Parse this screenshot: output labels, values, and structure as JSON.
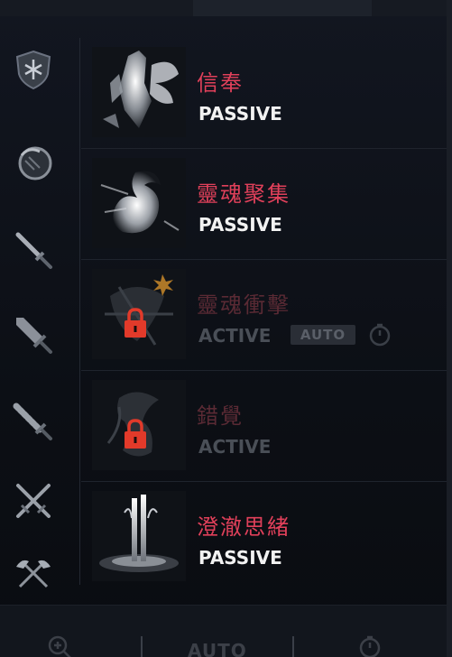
{
  "skills": [
    {
      "name": "信奉",
      "type": "PASSIVE",
      "locked": false
    },
    {
      "name": "靈魂聚集",
      "type": "PASSIVE",
      "locked": false
    },
    {
      "name": "靈魂衝擊",
      "type": "ACTIVE",
      "locked": true,
      "badge": "AUTO"
    },
    {
      "name": "錯覺",
      "type": "ACTIVE",
      "locked": true
    },
    {
      "name": "澄澈思緒",
      "type": "PASSIVE",
      "locked": false
    }
  ],
  "rail": {
    "icons": [
      "shield-emblem-icon",
      "ring-icon",
      "sword-icon",
      "broadsword-icon",
      "serrated-sword-icon",
      "crossed-swords-icon",
      "crossed-axes-icon"
    ]
  },
  "bottom_bar": {
    "auto_label": "AUTO",
    "icons": [
      "zoom-icon",
      "timer-icon"
    ]
  },
  "colors": {
    "skill_name": "#e0405a",
    "skill_type": "#f2f2f2",
    "lock": "#e23a2a",
    "background": "#0d1016"
  }
}
